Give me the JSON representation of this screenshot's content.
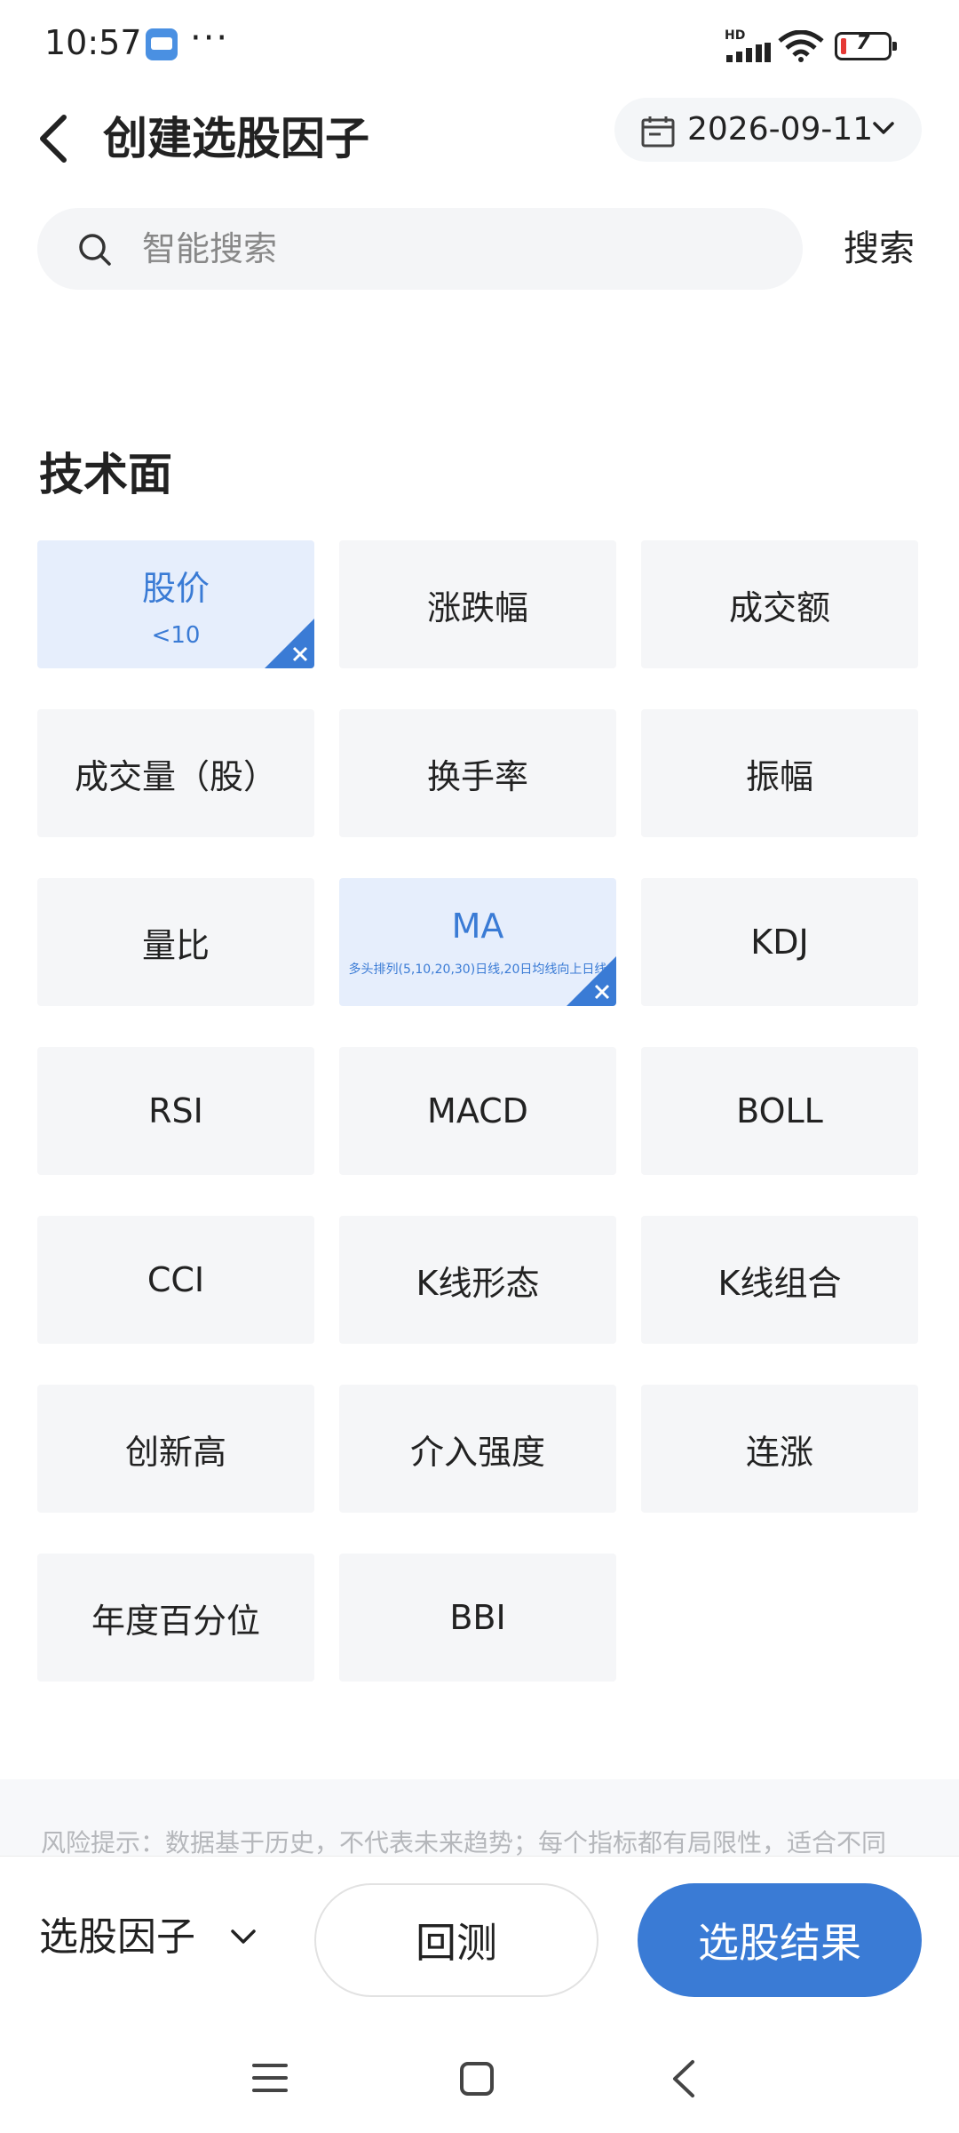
{
  "status_bar": {
    "time": "10:57",
    "more": "···",
    "hd": "HD",
    "battery_level": "7",
    "battery_color": "#e53935"
  },
  "header": {
    "title": "创建选股因子",
    "date": "2026-09-11",
    "back_icon": "chevron-left-icon",
    "calendar_icon": "calendar-icon"
  },
  "search": {
    "placeholder": "智能搜索",
    "button_label": "搜索",
    "icon": "search-icon"
  },
  "section": {
    "title": "技术面"
  },
  "tiles": [
    {
      "label": "股价",
      "sub": "<10",
      "selected": true
    },
    {
      "label": "涨跌幅",
      "selected": false
    },
    {
      "label": "成交额",
      "selected": false
    },
    {
      "label": "成交量（股）",
      "selected": false
    },
    {
      "label": "换手率",
      "selected": false
    },
    {
      "label": "振幅",
      "selected": false
    },
    {
      "label": "量比",
      "selected": false
    },
    {
      "label": "MA",
      "sub": "多头排列(5,10,20,30)日线,20日均线向上日线",
      "selected": true
    },
    {
      "label": "KDJ",
      "selected": false
    },
    {
      "label": "RSI",
      "selected": false
    },
    {
      "label": "MACD",
      "selected": false
    },
    {
      "label": "BOLL",
      "selected": false
    },
    {
      "label": "CCI",
      "selected": false
    },
    {
      "label": "K线形态",
      "selected": false
    },
    {
      "label": "K线组合",
      "selected": false
    },
    {
      "label": "创新高",
      "selected": false
    },
    {
      "label": "介入强度",
      "selected": false
    },
    {
      "label": "连涨",
      "selected": false
    },
    {
      "label": "年度百分位",
      "selected": false
    },
    {
      "label": "BBI",
      "selected": false
    }
  ],
  "disclaimer": "风险提示：数据基于历史，不代表未来趋势；每个指标都有局限性，适合不同",
  "bottom_bar": {
    "factor_label": "选股因子",
    "backtest_label": "回测",
    "results_label": "选股结果"
  },
  "colors": {
    "accent": "#3a7bd5",
    "selected_bg": "#e6eefc",
    "tile_bg": "#f5f6f8"
  }
}
